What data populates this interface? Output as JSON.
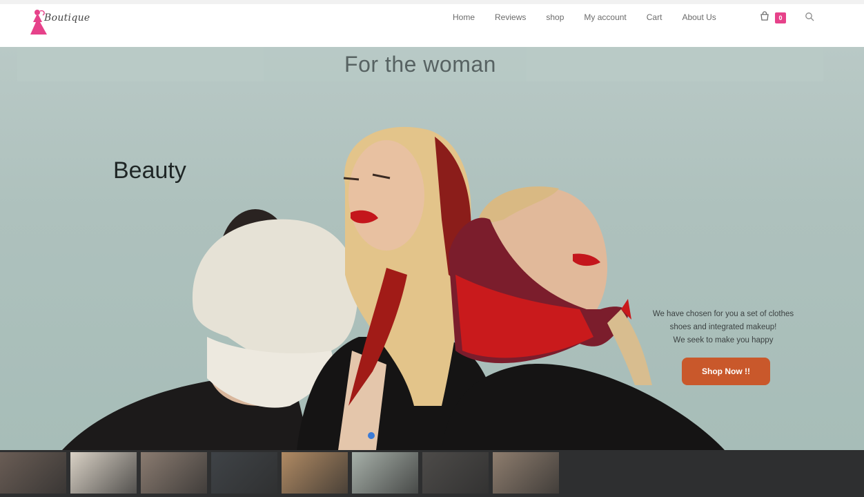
{
  "header": {
    "logo_text": "Boutique",
    "nav": [
      "Home",
      "Reviews",
      "shop",
      "My account",
      "Cart",
      "About Us"
    ],
    "cart_count": "0",
    "icons": {
      "cart": "shopping-bag-icon",
      "search": "search-icon",
      "logo": "dress-woman-logo-icon"
    }
  },
  "hero": {
    "banner_title": "For the woman",
    "heading": "Beauty",
    "tagline_lines": [
      "We have chosen for you a set of clothes",
      "shoes and integrated makeup!",
      "We seek to make you happy"
    ],
    "cta_label": "Shop Now !!",
    "slide_index": 1
  },
  "thumbnails": [
    {
      "name": "thumb-1",
      "tone": "#6a5d55"
    },
    {
      "name": "thumb-2",
      "tone": "#d9d1c5"
    },
    {
      "name": "thumb-3",
      "tone": "#8a7b70"
    },
    {
      "name": "thumb-4",
      "tone": "#3f4347"
    },
    {
      "name": "thumb-5",
      "tone": "#b08a63"
    },
    {
      "name": "thumb-6",
      "tone": "#a7b0a9"
    },
    {
      "name": "thumb-7",
      "tone": "#4d4b49"
    },
    {
      "name": "thumb-8",
      "tone": "#8e7d6e"
    }
  ],
  "colors": {
    "accent_pink": "#e6428a",
    "cta_orange": "#c9582b",
    "slider_dot": "#3b7bd6"
  }
}
